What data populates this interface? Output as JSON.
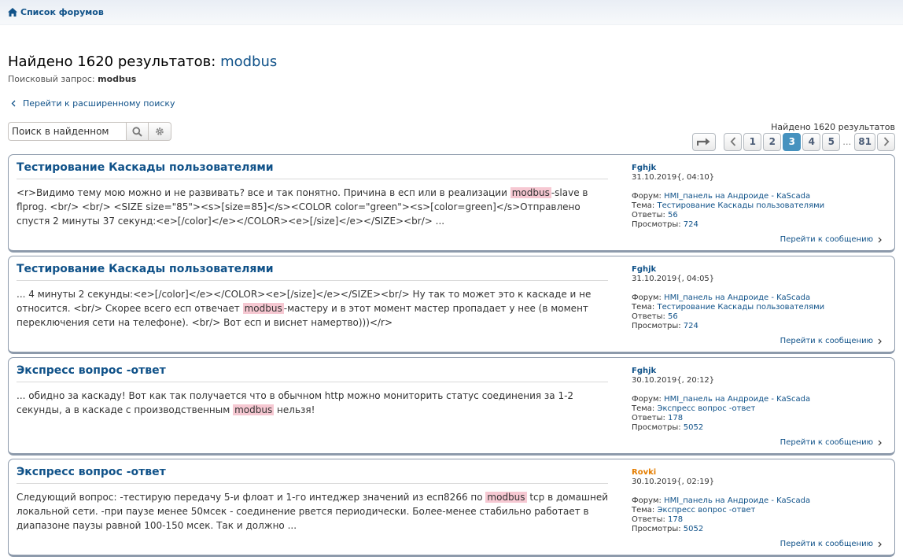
{
  "nav": {
    "forums_label": "Список форумов"
  },
  "heading": {
    "prefix": "Найдено 1620 результатов: ",
    "keyword": "modbus"
  },
  "query": {
    "label": "Поисковый запрос: ",
    "value": "modbus"
  },
  "advanced_link": "Перейти к расширенному поиску",
  "search": {
    "placeholder": "Поиск в найденном"
  },
  "found_count": "Найдено 1620 результатов",
  "pagination": {
    "pages": [
      "1",
      "2",
      "3",
      "4",
      "5"
    ],
    "current": "3",
    "ellipsis": "…",
    "last": "81"
  },
  "results": [
    {
      "title": "Тестирование Каскады пользователями",
      "text_before": "<r>Видимо тему мою можно и не развивать? все и так понятно. Причина в есп или в реализации ",
      "highlight": "modbus",
      "text_after": "-slave в flprog. <br/> <br/> <SIZE size=\"85\"><s>[size=85]</s><COLOR color=\"green\"><s>[color=green]</s>Отправлено спустя 2 минуты 37 секунд:<e>[/color]</e></COLOR><e>[/size]</e></SIZE><br/> ...",
      "author": "Fghjk",
      "date": "31.10.2019{, 04:10}",
      "forum_label": "Форум: ",
      "forum": "HMI_панель на Андроиде - KaScada",
      "topic_label": "Тема: ",
      "topic": "Тестирование Каскады пользователями",
      "replies_label": "Ответы: ",
      "replies": "56",
      "views_label": "Просмотры: ",
      "views": "724",
      "goto": "Перейти к сообщению"
    },
    {
      "title": "Тестирование Каскады пользователями",
      "text_before": "... 4 минуты 2 секунды:<e>[/color]</e></COLOR><e>[/size]</e></SIZE><br/> Ну так то может это к каскаде и не относится. <br/> Скорее всего есп отвечает ",
      "highlight": "modbus",
      "text_after": "-мастеру и в этот момент мастер пропадает у нее (в момент переключения сети на телефоне). <br/> Вот есп и виснет намертво)))</r>",
      "author": "Fghjk",
      "date": "31.10.2019{, 04:05}",
      "forum_label": "Форум: ",
      "forum": "HMI_панель на Андроиде - KaScada",
      "topic_label": "Тема: ",
      "topic": "Тестирование Каскады пользователями",
      "replies_label": "Ответы: ",
      "replies": "56",
      "views_label": "Просмотры: ",
      "views": "724",
      "goto": "Перейти к сообщению"
    },
    {
      "title": "Экспресс вопрос -ответ",
      "text_before": "... обидно за каскаду! Вот как так получается что в обычном http можно мониторить статус соединения за 1-2 секунды, а в каскаде с производственным ",
      "highlight": "modbus",
      "text_after": " нельзя!",
      "author": "Fghjk",
      "date": "30.10.2019{, 20:12}",
      "forum_label": "Форум: ",
      "forum": "HMI_панель на Андроиде - KaScada",
      "topic_label": "Тема: ",
      "topic": "Экспресс вопрос -ответ",
      "replies_label": "Ответы: ",
      "replies": "178",
      "views_label": "Просмотры: ",
      "views": "5052",
      "goto": "Перейти к сообщению"
    },
    {
      "title": "Экспресс вопрос -ответ",
      "text_before": "Следующий вопрос: -тестирую передачу 5-и флоат и 1-го интеджер значений из есп8266 по ",
      "highlight": "modbus",
      "text_after": " tcp в домашней локальной сети. -при паузе менее 50мсек - соединение рвется периодически. Более-менее стабильно работает в диапазоне паузы равной 100-150 мсек. Так и должно ...",
      "author": "Rovki",
      "date": "30.10.2019{, 02:19}",
      "forum_label": "Форум: ",
      "forum": "HMI_панель на Андроиде - KaScada",
      "topic_label": "Тема: ",
      "topic": "Экспресс вопрос -ответ",
      "replies_label": "Ответы: ",
      "replies": "178",
      "views_label": "Просмотры: ",
      "views": "5052",
      "goto": "Перейти к сообщению"
    }
  ],
  "colors": {
    "link": "#105289",
    "highlight": "#f6c8d2",
    "active_page": "#4692bf",
    "author_alt": "#e47d00"
  },
  "icons": {
    "home": "home-icon",
    "back": "chevron-left-icon",
    "search": "search-icon",
    "settings": "gear-icon",
    "jump": "jump-to-page-icon",
    "next": "chevron-right-icon"
  }
}
